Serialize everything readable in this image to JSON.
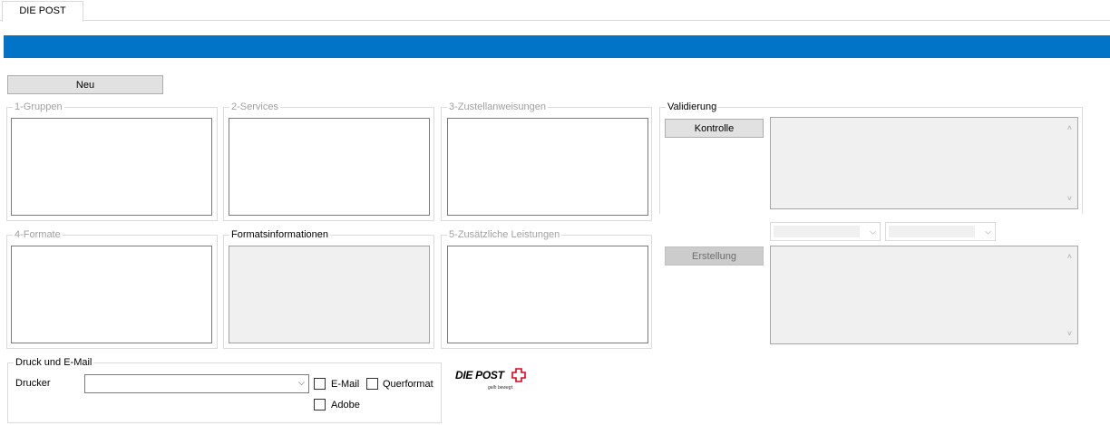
{
  "tabs": [
    {
      "label": "DIE POST"
    }
  ],
  "toolbar": {
    "new_label": "Neu"
  },
  "groups": {
    "gruppen": {
      "title": "1-Gruppen"
    },
    "services": {
      "title": "2-Services"
    },
    "zustellanweisungen": {
      "title": "3-Zustellanweisungen"
    },
    "formate": {
      "title": "4-Formate"
    },
    "formatsinformationen": {
      "title": "Formatsinformationen"
    },
    "zusaetzliche_leistungen": {
      "title": "5-Zusätzliche Leistungen"
    }
  },
  "validierung": {
    "title": "Validierung",
    "kontrolle_label": "Kontrolle",
    "erstellung_label": "Erstellung",
    "combo1_value": "",
    "combo2_value": ""
  },
  "print": {
    "title": "Druck und E-Mail",
    "printer_label": "Drucker",
    "printer_value": "",
    "email_label": "E-Mail",
    "querformat_label": "Querformat",
    "adobe_label": "Adobe",
    "email_checked": false,
    "querformat_checked": false,
    "adobe_checked": false
  },
  "logo": {
    "text": "DIE POST",
    "tagline": "gelb bewegt."
  },
  "colors": {
    "accent_bar": "#0274c8",
    "logo_red": "#e2001a"
  }
}
